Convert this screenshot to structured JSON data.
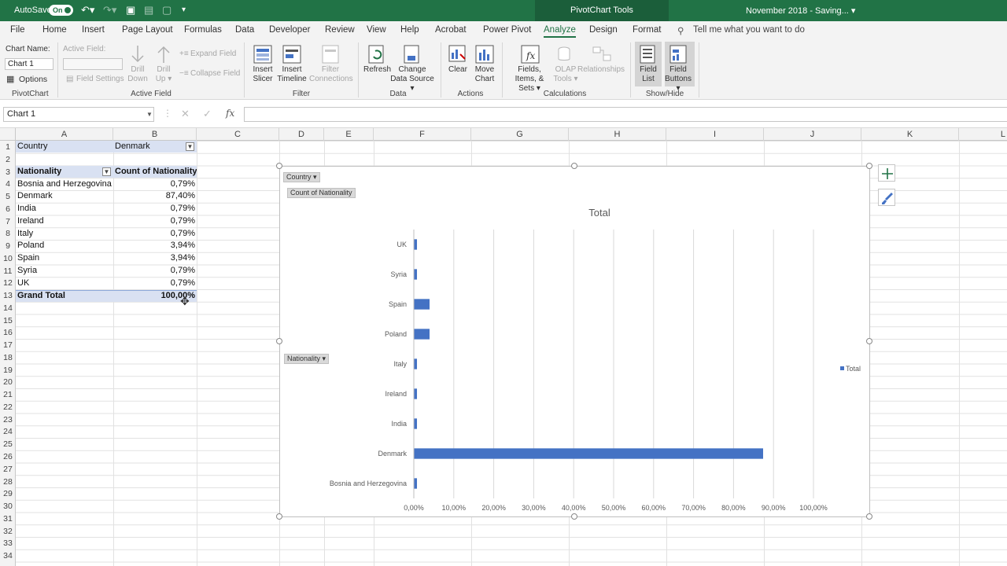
{
  "titlebar": {
    "autosave": "AutoSave",
    "toggle": "On",
    "context": "PivotChart Tools",
    "doc_title": "November 2018 - Saving... ▾"
  },
  "tabs": [
    "File",
    "Home",
    "Insert",
    "Page Layout",
    "Formulas",
    "Data",
    "Developer",
    "Review",
    "View",
    "Help",
    "Acrobat",
    "Power Pivot",
    "Analyze",
    "Design",
    "Format",
    "Tell me what you want to do"
  ],
  "ribbon": {
    "chart_name_label": "Chart Name:",
    "chart_name_value": "Chart 1",
    "options": "Options",
    "active_field_label": "Active Field:",
    "field_settings": "Field Settings",
    "drill_down": "Drill Down",
    "drill_up": "Drill Up ▾",
    "expand_field": "Expand Field",
    "collapse_field": "Collapse Field",
    "insert_slicer": "Insert Slicer",
    "insert_timeline": "Insert Timeline",
    "filter_connections": "Filter Connections",
    "refresh": "Refresh",
    "change_data_source": "Change Data Source ▾",
    "clear": "Clear",
    "move_chart": "Move Chart",
    "fields_items_sets": "Fields, Items, & Sets ▾",
    "olap_tools": "OLAP Tools ▾",
    "relationships": "Relationships",
    "field_list": "Field List",
    "field_buttons": "Field Buttons ▾",
    "groups": {
      "pivotchart": "PivotChart",
      "active_field": "Active Field",
      "filter": "Filter",
      "data": "Data",
      "actions": "Actions",
      "calculations": "Calculations",
      "show_hide": "Show/Hide"
    }
  },
  "namebox": "Chart 1",
  "columns": [
    "A",
    "B",
    "C",
    "D",
    "E",
    "F",
    "G",
    "H",
    "I",
    "J",
    "K",
    "L"
  ],
  "rows": [
    "1",
    "2",
    "3",
    "4",
    "5",
    "6",
    "7",
    "8",
    "9",
    "10",
    "11",
    "12",
    "13",
    "14",
    "15",
    "16",
    "17",
    "18",
    "19",
    "20",
    "21",
    "22",
    "23",
    "24",
    "25",
    "26",
    "27",
    "28",
    "29",
    "30",
    "31",
    "32",
    "33",
    "34"
  ],
  "sheet": {
    "filter_label": "Country",
    "filter_value": "Denmark",
    "header": [
      "Nationality",
      "Count of Nationality"
    ],
    "data": [
      [
        "Bosnia and Herzegovina",
        "0,79%"
      ],
      [
        "Denmark",
        "87,40%"
      ],
      [
        "India",
        "0,79%"
      ],
      [
        "Ireland",
        "0,79%"
      ],
      [
        "Italy",
        "0,79%"
      ],
      [
        "Poland",
        "3,94%"
      ],
      [
        "Spain",
        "3,94%"
      ],
      [
        "Syria",
        "0,79%"
      ],
      [
        "UK",
        "0,79%"
      ]
    ],
    "total": [
      "Grand Total",
      "100,00%"
    ]
  },
  "chart_field_buttons": {
    "country": "Country ▾",
    "value": "Count of Nationality",
    "axis": "Nationality ▾"
  },
  "chart_data": {
    "type": "bar",
    "orientation": "horizontal",
    "title": "Total",
    "categories": [
      "Bosnia and Herzegovina",
      "Denmark",
      "India",
      "Ireland",
      "Italy",
      "Poland",
      "Spain",
      "Syria",
      "UK"
    ],
    "series": [
      {
        "name": "Total",
        "values": [
          0.79,
          87.4,
          0.79,
          0.79,
          0.79,
          3.94,
          3.94,
          0.79,
          0.79
        ]
      }
    ],
    "xlim": [
      0,
      100
    ],
    "x_ticks": [
      "0,00%",
      "10,00%",
      "20,00%",
      "30,00%",
      "40,00%",
      "50,00%",
      "60,00%",
      "70,00%",
      "80,00%",
      "90,00%",
      "100,00%"
    ],
    "grid": true,
    "legend": "right",
    "color": "#4472c4"
  },
  "colors": {
    "excel_green": "#217346",
    "bar": "#4472c4",
    "pivot_band": "#d9e1f2"
  }
}
